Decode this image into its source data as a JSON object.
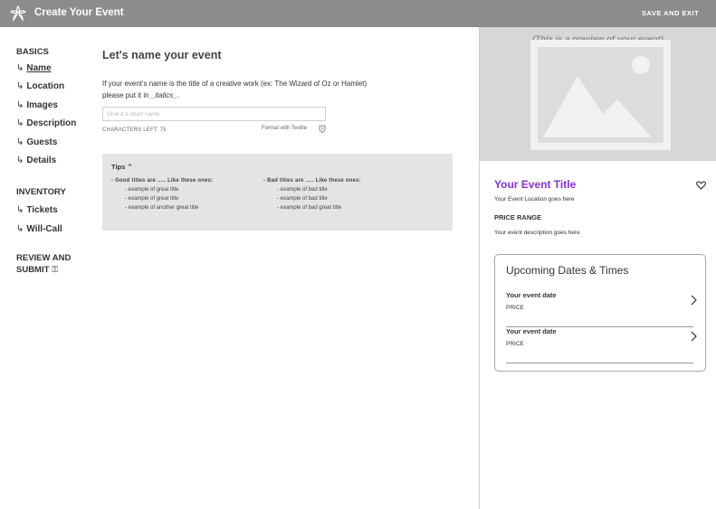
{
  "header": {
    "app_title": "Create Your Event",
    "save_exit": "SAVE AND EXIT"
  },
  "sidebar": {
    "sections": [
      {
        "title": "BASICS"
      },
      {
        "title": "INVENTORY"
      },
      {
        "title_line1": "REVIEW AND",
        "title_line2": "SUBMIT",
        "lock_glyph": "⚿"
      }
    ],
    "items": [
      {
        "arrow": "↳",
        "label": "Name"
      },
      {
        "arrow": "↳",
        "label": "Location"
      },
      {
        "arrow": "↳",
        "label": "Images"
      },
      {
        "arrow": "↳",
        "label": "Description"
      },
      {
        "arrow": "↳",
        "label": "Guests"
      },
      {
        "arrow": "↳",
        "label": "Details"
      },
      {
        "arrow": "↳",
        "label": "Tickets"
      },
      {
        "arrow": "↳",
        "label": "Will-Call"
      }
    ]
  },
  "form": {
    "heading": "Let's name your event",
    "help_line1": "If your event's name is the title of a creative work (ex: The Wizard of Oz or Hamlet)",
    "help_line2_prefix": "please put it in ",
    "help_line2_italic": "_italics_",
    "help_line2_suffix": ".",
    "name_placeholder": "Give it a short name",
    "name_value": "",
    "chars_left": "CHARACTERS LEFT: 75",
    "format_label": "Format with Textile"
  },
  "tips": {
    "title": "Tips",
    "caret": "⌃",
    "good_head": "- Good titles are ..... Like these ones:",
    "good": [
      "- example of great title",
      "- example of great title",
      "- example of another great title"
    ],
    "bad_head": "- Bad titles are ..... Like these ones:",
    "bad": [
      "- example of bad title",
      "- example of bad title",
      "- example of bad great title"
    ]
  },
  "preview": {
    "note": "(This is a preview of your event)",
    "event_title": "Your Event Title",
    "location": "Your Event Location goes here",
    "price_range": "PRICE RANGE",
    "description": "Your event description goes here",
    "dates_title": "Upcoming Dates & Times",
    "dates": [
      {
        "date": "Your event date",
        "price": "PRICE"
      },
      {
        "date": "Your event date",
        "price": "PRICE"
      }
    ]
  },
  "colors": {
    "topbar": "#8c8c8c",
    "accent_title": "#8a2be2",
    "tips_bg": "#e4e4e4",
    "preview_bg": "#d7d7d7"
  },
  "icons": {
    "logo": "flower-logo-icon",
    "format_help": "info-icon",
    "favorite": "heart-icon",
    "date_arrow": "chevron-right-icon",
    "image_placeholder": "image-placeholder-icon"
  }
}
